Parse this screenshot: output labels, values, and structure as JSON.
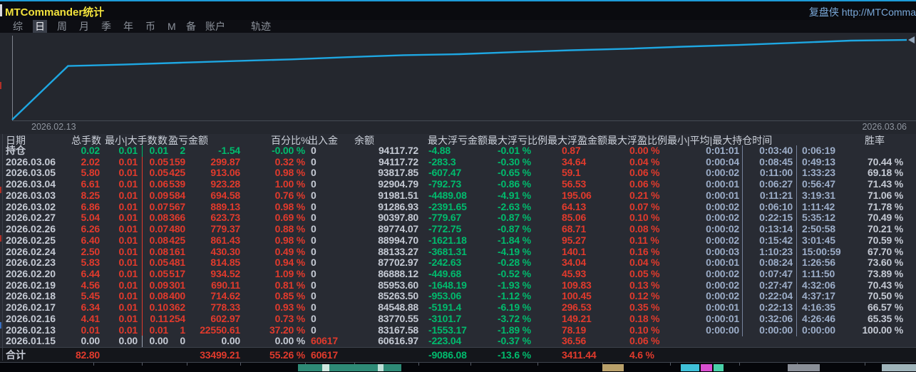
{
  "titlebar": {
    "title": "MTCommander统计",
    "link": "复盘侠 http://MTComma"
  },
  "tabs": {
    "items": [
      {
        "label": "综",
        "selected": false
      },
      {
        "label": "日",
        "selected": true
      },
      {
        "label": "周",
        "selected": false
      },
      {
        "label": "月",
        "selected": false
      },
      {
        "label": "季",
        "selected": false
      },
      {
        "label": "年",
        "selected": false
      },
      {
        "label": "币",
        "selected": false
      },
      {
        "label": "M",
        "selected": false
      },
      {
        "label": "备",
        "selected": false
      },
      {
        "label": "账户",
        "selected": false
      },
      {
        "label": "轨迹",
        "selected": false
      }
    ]
  },
  "chart": {
    "start_label": "2026.02.13",
    "end_label": "2026.03.06",
    "line_color": "#1ea7e2",
    "points": [
      {
        "date": "2026.01.15",
        "balance": 60616.97
      },
      {
        "date": "2026.02.13",
        "balance": 83167.58
      },
      {
        "date": "2026.02.16",
        "balance": 83770.55
      },
      {
        "date": "2026.02.17",
        "balance": 84548.88
      },
      {
        "date": "2026.02.18",
        "balance": 85263.5
      },
      {
        "date": "2026.02.19",
        "balance": 85953.6
      },
      {
        "date": "2026.02.20",
        "balance": 86888.12
      },
      {
        "date": "2026.02.23",
        "balance": 87702.97
      },
      {
        "date": "2026.02.24",
        "balance": 88133.27
      },
      {
        "date": "2026.02.25",
        "balance": 88994.7
      },
      {
        "date": "2026.02.26",
        "balance": 89774.07
      },
      {
        "date": "2026.02.27",
        "balance": 90397.8
      },
      {
        "date": "2026.03.02",
        "balance": 91286.93
      },
      {
        "date": "2026.03.03",
        "balance": 91981.51
      },
      {
        "date": "2026.03.04",
        "balance": 92904.79
      },
      {
        "date": "2026.03.05",
        "balance": 93817.85
      },
      {
        "date": "2026.03.06",
        "balance": 94117.72
      }
    ]
  },
  "table": {
    "header_labels": [
      "日期",
      "总手数",
      "最小|大手数",
      "数",
      "盈亏金额",
      "百分比%",
      "出入金",
      "余额",
      "最大浮亏金额",
      "最大浮亏比例",
      "最大浮盈金额",
      "最大浮盈比例",
      "最小|平均|最大持仓时间",
      "胜率"
    ],
    "rows": [
      {
        "date": "持仓",
        "lots": "0.02",
        "min": "0.01",
        "max": "0.01",
        "count": "2",
        "pnl": "-1.54",
        "pct": "-0.00 %",
        "cash": "0",
        "balance": "94117.72",
        "mfl": "-4.88",
        "mflp": "-0.01 %",
        "mfp": "0.87",
        "mfpp": "0.00 %",
        "tmin": "0:01:01",
        "tavg": "0:03:40",
        "tmax": "0:06:19",
        "win": "",
        "tone": "green",
        "cash_tone": "gray"
      },
      {
        "date": "2026.03.06",
        "lots": "2.02",
        "min": "0.01",
        "max": "0.05",
        "count": "159",
        "pnl": "299.87",
        "pct": "0.32 %",
        "cash": "0",
        "balance": "94117.72",
        "mfl": "-283.3",
        "mflp": "-0.30 %",
        "mfp": "34.64",
        "mfpp": "0.04 %",
        "tmin": "0:00:04",
        "tavg": "0:08:45",
        "tmax": "0:49:13",
        "win": "70.44 %",
        "tone": "red",
        "cash_tone": "gray"
      },
      {
        "date": "2026.03.05",
        "lots": "5.80",
        "min": "0.01",
        "max": "0.05",
        "count": "425",
        "pnl": "913.06",
        "pct": "0.98 %",
        "cash": "0",
        "balance": "93817.85",
        "mfl": "-607.47",
        "mflp": "-0.65 %",
        "mfp": "59.1",
        "mfpp": "0.06 %",
        "tmin": "0:00:02",
        "tavg": "0:11:00",
        "tmax": "1:33:23",
        "win": "69.18 %",
        "tone": "red",
        "cash_tone": "gray"
      },
      {
        "date": "2026.03.04",
        "lots": "6.61",
        "min": "0.01",
        "max": "0.06",
        "count": "539",
        "pnl": "923.28",
        "pct": "1.00 %",
        "cash": "0",
        "balance": "92904.79",
        "mfl": "-792.73",
        "mflp": "-0.86 %",
        "mfp": "56.53",
        "mfpp": "0.06 %",
        "tmin": "0:00:01",
        "tavg": "0:06:27",
        "tmax": "0:56:47",
        "win": "71.43 %",
        "tone": "red",
        "cash_tone": "gray"
      },
      {
        "date": "2026.03.03",
        "lots": "8.25",
        "min": "0.01",
        "max": "0.09",
        "count": "584",
        "pnl": "694.58",
        "pct": "0.76 %",
        "cash": "0",
        "balance": "91981.51",
        "mfl": "-4489.08",
        "mflp": "-4.91 %",
        "mfp": "195.06",
        "mfpp": "0.21 %",
        "tmin": "0:00:01",
        "tavg": "0:11:21",
        "tmax": "3:19:31",
        "win": "71.06 %",
        "tone": "red",
        "cash_tone": "gray"
      },
      {
        "date": "2026.03.02",
        "lots": "6.86",
        "min": "0.01",
        "max": "0.07",
        "count": "567",
        "pnl": "889.13",
        "pct": "0.98 %",
        "cash": "0",
        "balance": "91286.93",
        "mfl": "-2391.65",
        "mflp": "-2.63 %",
        "mfp": "64.13",
        "mfpp": "0.07 %",
        "tmin": "0:00:02",
        "tavg": "0:06:10",
        "tmax": "1:11:42",
        "win": "71.78 %",
        "tone": "red",
        "cash_tone": "gray"
      },
      {
        "date": "2026.02.27",
        "lots": "5.04",
        "min": "0.01",
        "max": "0.08",
        "count": "366",
        "pnl": "623.73",
        "pct": "0.69 %",
        "cash": "0",
        "balance": "90397.80",
        "mfl": "-779.67",
        "mflp": "-0.87 %",
        "mfp": "85.06",
        "mfpp": "0.10 %",
        "tmin": "0:00:02",
        "tavg": "0:22:15",
        "tmax": "5:35:12",
        "win": "70.49 %",
        "tone": "red",
        "cash_tone": "gray"
      },
      {
        "date": "2026.02.26",
        "lots": "6.26",
        "min": "0.01",
        "max": "0.07",
        "count": "480",
        "pnl": "779.37",
        "pct": "0.88 %",
        "cash": "0",
        "balance": "89774.07",
        "mfl": "-772.75",
        "mflp": "-0.87 %",
        "mfp": "68.71",
        "mfpp": "0.08 %",
        "tmin": "0:00:02",
        "tavg": "0:13:14",
        "tmax": "2:50:58",
        "win": "70.21 %",
        "tone": "red",
        "cash_tone": "gray"
      },
      {
        "date": "2026.02.25",
        "lots": "6.40",
        "min": "0.01",
        "max": "0.08",
        "count": "425",
        "pnl": "861.43",
        "pct": "0.98 %",
        "cash": "0",
        "balance": "88994.70",
        "mfl": "-1621.18",
        "mflp": "-1.84 %",
        "mfp": "95.27",
        "mfpp": "0.11 %",
        "tmin": "0:00:02",
        "tavg": "0:15:42",
        "tmax": "3:01:45",
        "win": "70.59 %",
        "tone": "red",
        "cash_tone": "gray"
      },
      {
        "date": "2026.02.24",
        "lots": "2.50",
        "min": "0.01",
        "max": "0.08",
        "count": "161",
        "pnl": "430.30",
        "pct": "0.49 %",
        "cash": "0",
        "balance": "88133.27",
        "mfl": "-3681.31",
        "mflp": "-4.19 %",
        "mfp": "140.1",
        "mfpp": "0.16 %",
        "tmin": "0:00:03",
        "tavg": "1:10:23",
        "tmax": "15:00:59",
        "win": "67.70 %",
        "tone": "red",
        "cash_tone": "gray"
      },
      {
        "date": "2026.02.23",
        "lots": "5.83",
        "min": "0.01",
        "max": "0.05",
        "count": "481",
        "pnl": "814.85",
        "pct": "0.94 %",
        "cash": "0",
        "balance": "87702.97",
        "mfl": "-242.63",
        "mflp": "-0.28 %",
        "mfp": "34.04",
        "mfpp": "0.04 %",
        "tmin": "0:00:01",
        "tavg": "0:08:24",
        "tmax": "1:26:56",
        "win": "73.60 %",
        "tone": "red",
        "cash_tone": "gray"
      },
      {
        "date": "2026.02.20",
        "lots": "6.44",
        "min": "0.01",
        "max": "0.05",
        "count": "517",
        "pnl": "934.52",
        "pct": "1.09 %",
        "cash": "0",
        "balance": "86888.12",
        "mfl": "-449.68",
        "mflp": "-0.52 %",
        "mfp": "45.93",
        "mfpp": "0.05 %",
        "tmin": "0:00:02",
        "tavg": "0:07:47",
        "tmax": "1:11:50",
        "win": "73.89 %",
        "tone": "red",
        "cash_tone": "gray"
      },
      {
        "date": "2026.02.19",
        "lots": "4.56",
        "min": "0.01",
        "max": "0.09",
        "count": "301",
        "pnl": "690.11",
        "pct": "0.81 %",
        "cash": "0",
        "balance": "85953.60",
        "mfl": "-1648.19",
        "mflp": "-1.93 %",
        "mfp": "109.83",
        "mfpp": "0.13 %",
        "tmin": "0:00:02",
        "tavg": "0:27:47",
        "tmax": "4:32:06",
        "win": "70.43 %",
        "tone": "red",
        "cash_tone": "gray"
      },
      {
        "date": "2026.02.18",
        "lots": "5.45",
        "min": "0.01",
        "max": "0.08",
        "count": "400",
        "pnl": "714.62",
        "pct": "0.85 %",
        "cash": "0",
        "balance": "85263.50",
        "mfl": "-953.06",
        "mflp": "-1.12 %",
        "mfp": "100.45",
        "mfpp": "0.12 %",
        "tmin": "0:00:02",
        "tavg": "0:22:04",
        "tmax": "4:37:17",
        "win": "70.50 %",
        "tone": "red",
        "cash_tone": "gray"
      },
      {
        "date": "2026.02.17",
        "lots": "6.34",
        "min": "0.01",
        "max": "0.10",
        "count": "362",
        "pnl": "778.33",
        "pct": "0.93 %",
        "cash": "0",
        "balance": "84548.88",
        "mfl": "-5191.4",
        "mflp": "-6.19 %",
        "mfp": "296.53",
        "mfpp": "0.35 %",
        "tmin": "0:00:01",
        "tavg": "0:22:13",
        "tmax": "4:16:35",
        "win": "66.57 %",
        "tone": "red",
        "cash_tone": "gray"
      },
      {
        "date": "2026.02.16",
        "lots": "4.41",
        "min": "0.01",
        "max": "0.11",
        "count": "254",
        "pnl": "602.97",
        "pct": "0.73 %",
        "cash": "0",
        "balance": "83770.55",
        "mfl": "-3101.7",
        "mflp": "-3.72 %",
        "mfp": "149.21",
        "mfpp": "0.18 %",
        "tmin": "0:00:01",
        "tavg": "0:32:06",
        "tmax": "4:26:46",
        "win": "65.35 %",
        "tone": "red",
        "cash_tone": "gray"
      },
      {
        "date": "2026.02.13",
        "lots": "0.01",
        "min": "0.01",
        "max": "0.01",
        "count": "1",
        "pnl": "22550.61",
        "pct": "37.20 %",
        "cash": "0",
        "balance": "83167.58",
        "mfl": "-1553.17",
        "mflp": "-1.89 %",
        "mfp": "78.19",
        "mfpp": "0.10 %",
        "tmin": "0:00:00",
        "tavg": "0:00:00",
        "tmax": "0:00:00",
        "win": "100.00 %",
        "tone": "red",
        "cash_tone": "gray"
      },
      {
        "date": "2026.01.15",
        "lots": "0.00",
        "min": "0.00",
        "max": "0.00",
        "count": "0",
        "pnl": "0.00",
        "pct": "0.00 %",
        "cash": "60617",
        "balance": "60616.97",
        "mfl": "-223.04",
        "mflp": "-0.37 %",
        "mfp": "36.56",
        "mfpp": "0.06 %",
        "tmin": "",
        "tavg": "",
        "tmax": "",
        "win": "",
        "tone": "gray",
        "cash_tone": "red"
      }
    ],
    "total": {
      "date": "合计",
      "lots": "82.80",
      "min": "",
      "max": "",
      "count": "",
      "pnl": "33499.21",
      "pct": "55.26 %",
      "cash": "60617",
      "balance": "",
      "mfl": "-9086.08",
      "mflp": "-13.6 %",
      "mfp": "3411.44",
      "mfpp": "4.6 %",
      "tmin": "",
      "tavg": "",
      "tmax": "",
      "win": "",
      "tone": "red",
      "cash_tone": "red"
    }
  }
}
